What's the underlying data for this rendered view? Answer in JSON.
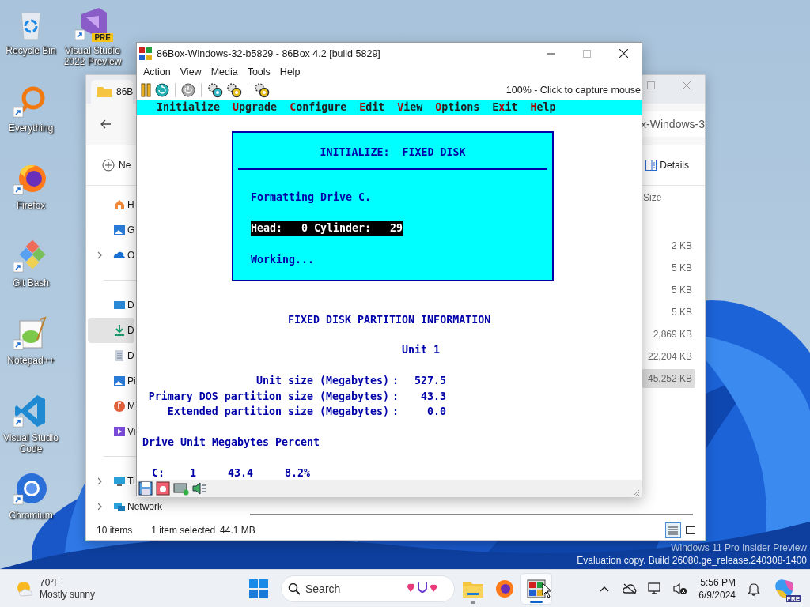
{
  "desktop_icons": [
    {
      "label": "Recycle Bin"
    },
    {
      "label": "Visual Studio 2022 Preview",
      "badge": "PRE"
    },
    {
      "label": "Everything"
    },
    {
      "label": "Firefox"
    },
    {
      "label": "Git Bash"
    },
    {
      "label": "Notepad++"
    },
    {
      "label": "Visual Studio Code"
    },
    {
      "label": "Chromium"
    }
  ],
  "explorer": {
    "tab_title": "86B",
    "address": "x-Windows-3",
    "new_button": "Ne",
    "details_button": "Details",
    "sidebar": {
      "groups": [
        [
          {
            "label": "H",
            "selected": false
          },
          {
            "label": "G",
            "selected": false
          },
          {
            "label": "O",
            "selected": false,
            "expanded": false
          }
        ],
        [
          {
            "label": "D",
            "selected": false
          },
          {
            "label": "D",
            "selected": true
          },
          {
            "label": "D",
            "selected": false
          },
          {
            "label": "Pi",
            "selected": false
          },
          {
            "label": "M",
            "selected": false
          },
          {
            "label": "Vi",
            "selected": false
          }
        ],
        [
          {
            "label": "Ti",
            "selected": false,
            "expanded": false
          },
          {
            "label": "Network",
            "selected": false,
            "expanded": false
          }
        ]
      ]
    },
    "column_header": "Size",
    "rows": [
      {
        "size": "2 KB",
        "selected": false
      },
      {
        "size": "5 KB",
        "selected": false
      },
      {
        "size": "5 KB",
        "selected": false
      },
      {
        "size": "5 KB",
        "selected": false
      },
      {
        "size": "2,869 KB",
        "selected": false
      },
      {
        "size": "22,204 KB",
        "selected": false
      },
      {
        "size": "45,252 KB",
        "selected": true
      }
    ],
    "status_bar": {
      "item_count": "10 items",
      "selection": "1 item selected",
      "selection_size": "44.1 MB"
    },
    "view_buttons": [
      {
        "selected": true
      },
      {
        "selected": false
      }
    ]
  },
  "emulator": {
    "title": "86Box-Windows-32-b5829 - 86Box 4.2 [build 5829]",
    "menu": [
      "Action",
      "View",
      "Media",
      "Tools",
      "Help"
    ],
    "capture_hint": "100% - Click to capture mouse",
    "screen": {
      "menu": [
        {
          "parts": [
            {
              "text": "Initialize",
              "hotkey": false
            }
          ]
        },
        {
          "parts": [
            {
              "text": "U",
              "hotkey": true
            },
            {
              "text": "pgrade",
              "hotkey": false
            }
          ]
        },
        {
          "parts": [
            {
              "text": "C",
              "hotkey": true
            },
            {
              "text": "onfigure",
              "hotkey": false
            }
          ]
        },
        {
          "parts": [
            {
              "text": "E",
              "hotkey": true
            },
            {
              "text": "dit",
              "hotkey": false
            }
          ]
        },
        {
          "parts": [
            {
              "text": "V",
              "hotkey": true
            },
            {
              "text": "iew",
              "hotkey": false
            }
          ]
        },
        {
          "parts": [
            {
              "text": "O",
              "hotkey": true
            },
            {
              "text": "ptions",
              "hotkey": false
            }
          ]
        },
        {
          "parts": [
            {
              "text": "E",
              "hotkey": false
            },
            {
              "text": "x",
              "hotkey": true
            },
            {
              "text": "it",
              "hotkey": false
            }
          ]
        },
        {
          "parts": [
            {
              "text": "H",
              "hotkey": true
            },
            {
              "text": "elp",
              "hotkey": false
            }
          ]
        }
      ],
      "dialog": {
        "title": "INITIALIZE:  FIXED DISK",
        "message": "Formatting Drive C.",
        "progress": "Head:   0 Cylinder:   29",
        "status": "Working..."
      },
      "partition_info": {
        "title": "FIXED DISK PARTITION INFORMATION",
        "unit": "Unit 1",
        "rows": [
          {
            "label": "Unit size (Megabytes)",
            "separator": ":",
            "value": "527.5"
          },
          {
            "label": "Primary DOS partition size (Megabytes)",
            "separator": ":",
            "value": "43.3"
          },
          {
            "label": "Extended partition size (Megabytes)",
            "separator": ":",
            "value": "0.0"
          }
        ],
        "columns": [
          "Drive",
          "Unit",
          "Megabytes",
          "Percent"
        ],
        "drives": [
          [
            "C:",
            "1",
            "43.4",
            "8.2%"
          ]
        ]
      }
    }
  },
  "watermark": [
    "Windows 11 Pro Insider Preview",
    "Evaluation copy. Build 26080.ge_release.240308-1400"
  ],
  "taskbar": {
    "weather": {
      "temperature": "70°F",
      "condition": "Mostly sunny"
    },
    "search": {
      "placeholder": "Search"
    },
    "apps": [
      {
        "selected": false,
        "running": true
      },
      {
        "selected": false,
        "running": false
      },
      {
        "selected": true,
        "running": true
      }
    ],
    "clock": {
      "time": "5:56 PM",
      "date": "6/9/2024"
    },
    "copilot_badge": "PRE"
  }
}
